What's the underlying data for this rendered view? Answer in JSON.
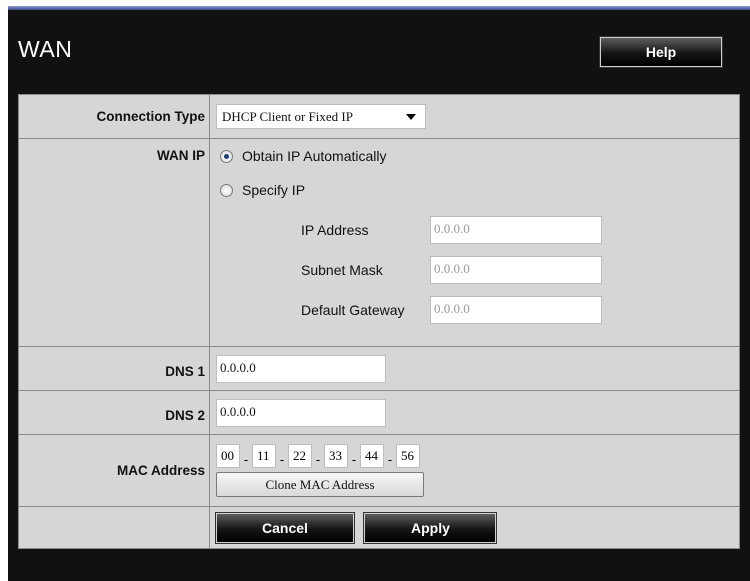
{
  "header": {
    "title": "WAN",
    "help_label": "Help"
  },
  "form": {
    "connection_type": {
      "label": "Connection Type",
      "selected": "DHCP Client or Fixed IP"
    },
    "wan_ip": {
      "label": "WAN IP",
      "options": [
        {
          "label": "Obtain IP Automatically",
          "checked": true
        },
        {
          "label": "Specify IP",
          "checked": false
        }
      ],
      "fields": [
        {
          "label": "IP Address",
          "value": "0.0.0.0"
        },
        {
          "label": "Subnet Mask",
          "value": "0.0.0.0"
        },
        {
          "label": "Default Gateway",
          "value": "0.0.0.0"
        }
      ]
    },
    "dns1": {
      "label": "DNS 1",
      "value": "0.0.0.0"
    },
    "dns2": {
      "label": "DNS 2",
      "value": "0.0.0.0"
    },
    "mac": {
      "label": "MAC Address",
      "octets": [
        "00",
        "11",
        "22",
        "33",
        "44",
        "56"
      ],
      "separator": "-",
      "clone_label": "Clone MAC Address"
    }
  },
  "actions": {
    "cancel_label": "Cancel",
    "apply_label": "Apply"
  }
}
